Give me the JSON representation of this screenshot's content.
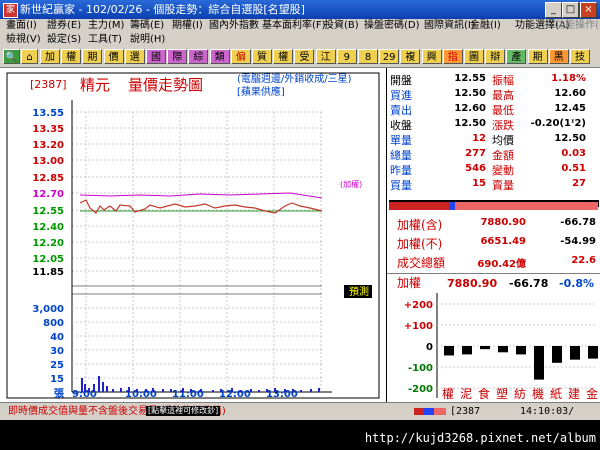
{
  "window": {
    "title": "新世紀贏家 - 102/02/26 - 個股走勢：綜合自選股[名望股]",
    "minimize_glyph": "_",
    "maximize_glyph": "□",
    "close_glyph": "×"
  },
  "menu_row1": [
    "畫面(I)",
    "證券(E)",
    "主力(M)",
    "籌碼(E)",
    "期權(I)",
    "國內外指數",
    "基本面利率(F)",
    "投資(B)",
    "操盤密碼(D)",
    "國際資訊(I)",
    "金融(I)",
    "功能選擇(A)",
    "功能操作(F)"
  ],
  "menu_row2": [
    "檢視(V)",
    "設定(S)",
    "工具(T)",
    "說明(H)"
  ],
  "toolbar": {
    "buttons": [
      "加",
      "權",
      "期",
      "價",
      "選",
      "國",
      "際",
      "綜",
      "類",
      "偏",
      "質",
      "權",
      "受",
      "江",
      "9",
      "8",
      "29",
      "複",
      "興",
      "指",
      "圖",
      "辯",
      "產",
      "期",
      "黑",
      "技"
    ]
  },
  "stock": {
    "code": "[2387]",
    "name": "精元",
    "chart_title": "量價走勢圖",
    "category": "(電腦週邊/外銷收成/三星)",
    "supplier": "[蘋果供應]",
    "ref_tag": "(加權)",
    "forecast_tag": "預測"
  },
  "price_axis": [
    "13.55",
    "13.35",
    "13.20",
    "13.00",
    "12.85",
    "12.70",
    "12.55",
    "12.40",
    "12.20",
    "12.05",
    "11.85"
  ],
  "volume_axis": [
    "3,000",
    "800",
    "40",
    "30",
    "25",
    "15",
    "張"
  ],
  "time_axis": [
    "9:00",
    "10:00",
    "11:00",
    "12:00",
    "13:00"
  ],
  "quote": {
    "open": {
      "label": "開盤",
      "value": "12.55"
    },
    "amplitude": {
      "label": "振幅",
      "value": "1.18%"
    },
    "bid": {
      "label": "買進",
      "value": "12.50"
    },
    "high": {
      "label": "最高",
      "value": "12.60"
    },
    "ask": {
      "label": "賣出",
      "value": "12.60"
    },
    "low": {
      "label": "最低",
      "value": "12.45"
    },
    "close": {
      "label": "收盤",
      "value": "12.50"
    },
    "change": {
      "label": "漲跌",
      "value": "-0.20(1ᶦ2)"
    },
    "single": {
      "label": "單量",
      "value": "12"
    },
    "avg": {
      "label": "均價",
      "value": "12.50"
    },
    "total_vol": {
      "label": "總量",
      "value": "277"
    },
    "amount": {
      "label": "金額",
      "value": "0.03"
    },
    "prev_vol": {
      "label": "昨量",
      "value": "546"
    },
    "turnover": {
      "label": "變動",
      "value": "0.51"
    },
    "buy_vol": {
      "label": "買量",
      "value": "15"
    },
    "sell_vol": {
      "label": "賣量",
      "value": "27"
    }
  },
  "index_box": {
    "with": {
      "label": "加權(含)",
      "value": "7880.90",
      "change": "-66.78"
    },
    "without": {
      "label": "加權(不)",
      "value": "6651.49",
      "change": "-54.99"
    },
    "turnover": {
      "label": "成交總額",
      "value": "690.42億",
      "change": "22.6"
    }
  },
  "sector": {
    "label": "加權",
    "value": "7880.90",
    "change": "-66.78",
    "pct": "-0.8%",
    "axis": [
      "+200",
      "+100",
      "0",
      "-100",
      "-200"
    ],
    "categories": [
      "權",
      "泥",
      "食",
      "塑",
      "紡",
      "機",
      "紙",
      "建",
      "金"
    ],
    "values": [
      -45,
      -40,
      -15,
      -30,
      -40,
      -160,
      -80,
      -65,
      -60
    ]
  },
  "statusbar": {
    "note": "即時價成交值與量不含盤後交易量(淨值為預估值)",
    "overlay": "[點擊這裡可修改鈔]",
    "code": "[2387",
    "time": "14:10:03/"
  },
  "url": "http://kujd3268.pixnet.net/album",
  "colors": {
    "price_line": "#c0392b",
    "avg_line": "#2e9a2e",
    "ref_line": "#cc00cc",
    "volume": "#2222cc",
    "up": "#cc0000",
    "down": "#007700"
  }
}
